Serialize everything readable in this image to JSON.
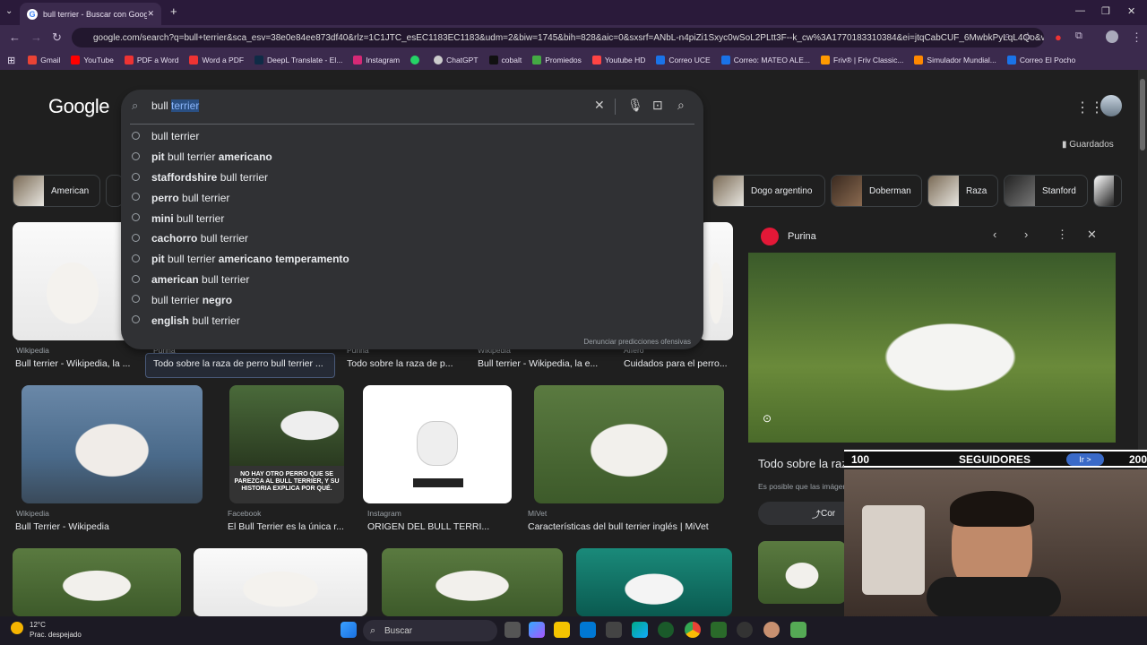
{
  "browser": {
    "tab_title": "bull terrier - Buscar con Google",
    "url": "google.com/search?q=bull+terrier&sca_esv=38e0e84ee873df40&rlz=1C1JTC_esEC1183EC1183&udm=2&biw=1745&bih=828&aic=0&sxsrf=ANbL-n4piZi1Sxyc0wSoL2PLtt3F--k_cw%3A1770183310384&ei=jtqCabCUF_6MwbkPyLqL4Qo&ved=...",
    "bookmarks": [
      "Gmail",
      "YouTube",
      "PDF a Word",
      "Word a PDF",
      "DeepL Translate - El...",
      "Instagram",
      "ChatGPT",
      "cobalt",
      "Promiedos",
      "Youtube HD",
      "Correo UCE",
      "Correo: MATEO ALE...",
      "Friv® | Friv Classic...",
      "Simulador Mundial...",
      "Correo El Pocho"
    ]
  },
  "google": {
    "logo": "Google",
    "query_plain": "bull ",
    "query_selected": "terrier",
    "saved_label": "Guardados",
    "suggestions": [
      {
        "pre": "",
        "mid": "bull terrier",
        "post": ""
      },
      {
        "pre": "pit",
        "mid": " bull terrier ",
        "post": "americano"
      },
      {
        "pre": "staffordshire",
        "mid": " bull terrier",
        "post": ""
      },
      {
        "pre": "perro",
        "mid": " bull terrier",
        "post": ""
      },
      {
        "pre": "mini",
        "mid": " bull terrier",
        "post": ""
      },
      {
        "pre": "cachorro",
        "mid": " bull terrier",
        "post": ""
      },
      {
        "pre": "pit",
        "mid": " bull terrier ",
        "post": "americano temperamento"
      },
      {
        "pre": "american",
        "mid": " bull terrier",
        "post": ""
      },
      {
        "pre": "",
        "mid": "bull terrier ",
        "post": "negro"
      },
      {
        "pre": "english",
        "mid": " bull terrier",
        "post": ""
      }
    ],
    "report_label": "Denunciar predicciones ofensivas",
    "chips": [
      "American",
      "Dogo argentino",
      "Doberman",
      "Raza",
      "Stanford"
    ]
  },
  "results": {
    "row1": [
      {
        "source": "Wikipedia",
        "caption": "Bull terrier - Wikipedia, la ..."
      },
      {
        "source": "Purina",
        "caption": "Todo sobre la raza de perro bull terrier ..."
      },
      {
        "source": "Purina",
        "caption": "Todo sobre la raza de p..."
      },
      {
        "source": "Wikipedia",
        "caption": "Bull terrier - Wikipedia, la e..."
      },
      {
        "source": "Affero",
        "caption": "Cuidados para el perro..."
      }
    ],
    "row2": [
      {
        "source": "Wikipedia",
        "caption": "Bull Terrier - Wikipedia"
      },
      {
        "source": "Facebook",
        "caption": "El Bull Terrier es la única r..."
      },
      {
        "source": "Instagram",
        "caption": "ORIGEN DEL BULL TERRI..."
      },
      {
        "source": "MiVet",
        "caption": "Características del bull terrier inglés | MiVet"
      }
    ],
    "img_text": "NO HAY OTRO PERRO QUE SE PAREZCA AL BULL TERRIER, Y SU HISTORIA EXPLICA POR QUÉ."
  },
  "panel": {
    "source": "Purina",
    "title": "Todo sobre la raz",
    "subtitle": "Es posible que las imágen",
    "share_label": "Cor"
  },
  "overlay": {
    "left": "100",
    "middle": "SEGUIDORES",
    "button": "Ir >",
    "right": "200"
  },
  "taskbar": {
    "temp": "12°C",
    "weather": "Prac. despejado",
    "search": "Buscar"
  }
}
